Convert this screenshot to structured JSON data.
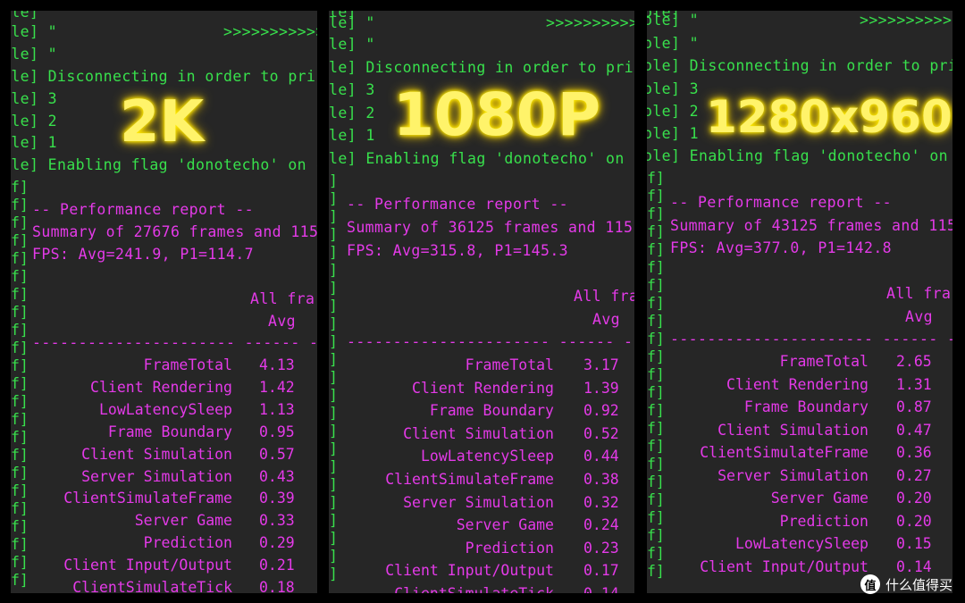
{
  "panels": [
    {
      "resolution": "2K",
      "header": {
        "l1": "ole]",
        "l2": "ole] \"",
        "l2_arrows": ">>>>>>>>>>>>>",
        "l3": "ole] \"",
        "l4": "ole] Disconnecting in order to pri",
        "l5": "ole] 3",
        "l6": "ole] 2",
        "l7": "ole] 1",
        "l8": "ole] Enabling flag 'donotecho' on c"
      },
      "report": {
        "title": "-- Performance report --",
        "summary": "Summary of 27676 frames and 115",
        "fps": "FPS: Avg=241.9, P1=114.7",
        "col_header": "All fra",
        "col_avg": "Avg",
        "divider": "---------------------- ------ -"
      },
      "rows": [
        {
          "label": "FrameTotal",
          "value": "4.13"
        },
        {
          "label": "Client Rendering",
          "value": "1.42"
        },
        {
          "label": "LowLatencySleep",
          "value": "1.13"
        },
        {
          "label": "Frame Boundary",
          "value": "0.95"
        },
        {
          "label": "Client Simulation",
          "value": "0.57"
        },
        {
          "label": "Server Simulation",
          "value": "0.43"
        },
        {
          "label": "ClientSimulateFrame",
          "value": "0.39"
        },
        {
          "label": "Server Game",
          "value": "0.33"
        },
        {
          "label": "Prediction",
          "value": "0.29"
        },
        {
          "label": "Client Input/Output",
          "value": "0.21"
        },
        {
          "label": "ClientSimulateTick",
          "value": "0.18"
        }
      ]
    },
    {
      "resolution": "1080P",
      "header": {
        "l1": "le]",
        "l2": "le] \"",
        "l2_arrows": ">>>>>>>>>>>",
        "l3": "le] \"",
        "l4": "le] Disconnecting in order to pri",
        "l5": "le] 3",
        "l6": "le] 2",
        "l7": "le] 1",
        "l8": "le] Enabling flag 'donotecho' on c"
      },
      "report": {
        "title": "-- Performance report --",
        "summary": "Summary of 36125 frames and 115",
        "fps": "FPS: Avg=315.8, P1=145.3",
        "col_header": "All fra",
        "col_avg": "Avg",
        "divider": "---------------------- ------ -"
      },
      "rows": [
        {
          "label": "FrameTotal",
          "value": "3.17"
        },
        {
          "label": "Client Rendering",
          "value": "1.39"
        },
        {
          "label": "Frame Boundary",
          "value": "0.92"
        },
        {
          "label": "Client Simulation",
          "value": "0.52"
        },
        {
          "label": "LowLatencySleep",
          "value": "0.44"
        },
        {
          "label": "ClientSimulateFrame",
          "value": "0.38"
        },
        {
          "label": "Server Simulation",
          "value": "0.32"
        },
        {
          "label": "Server Game",
          "value": "0.24"
        },
        {
          "label": "Prediction",
          "value": "0.23"
        },
        {
          "label": "Client Input/Output",
          "value": "0.17"
        },
        {
          "label": "ClientSimulateTick",
          "value": "0.14"
        }
      ]
    },
    {
      "resolution": "1280x960",
      "header": {
        "l1": "ole]",
        "l2": "ole] \"",
        "l2_arrows": ">>>>>>>>>>>",
        "l3": "ole] \"",
        "l4": "ole] Disconnecting in order to pri",
        "l5": "ole] 3",
        "l6": "ole] 2",
        "l7": "ole] 1",
        "l8": "ole] Enabling flag 'donotecho' on c"
      },
      "report": {
        "title": "-- Performance report --",
        "summary": "Summary of 43125 frames and 115",
        "fps": "FPS: Avg=377.0, P1=142.8",
        "col_header": "All fra",
        "col_avg": "Avg",
        "divider": "---------------------- ------ -"
      },
      "rows": [
        {
          "label": "FrameTotal",
          "value": "2.65"
        },
        {
          "label": "Client Rendering",
          "value": "1.31"
        },
        {
          "label": "Frame Boundary",
          "value": "0.87"
        },
        {
          "label": "Client Simulation",
          "value": "0.47"
        },
        {
          "label": "ClientSimulateFrame",
          "value": "0.36"
        },
        {
          "label": "Server Simulation",
          "value": "0.27"
        },
        {
          "label": "Server Game",
          "value": "0.20"
        },
        {
          "label": "Prediction",
          "value": "0.20"
        },
        {
          "label": "LowLatencySleep",
          "value": "0.15"
        },
        {
          "label": "Client Input/Output",
          "value": "0.14"
        }
      ]
    }
  ],
  "watermark": {
    "logo": "值",
    "text": "什么值得买"
  },
  "colors": {
    "console_green": "#38e04c",
    "report_magenta": "#e43ae8",
    "label_yellow": "#fff36a",
    "panel_bg": "#262626"
  }
}
